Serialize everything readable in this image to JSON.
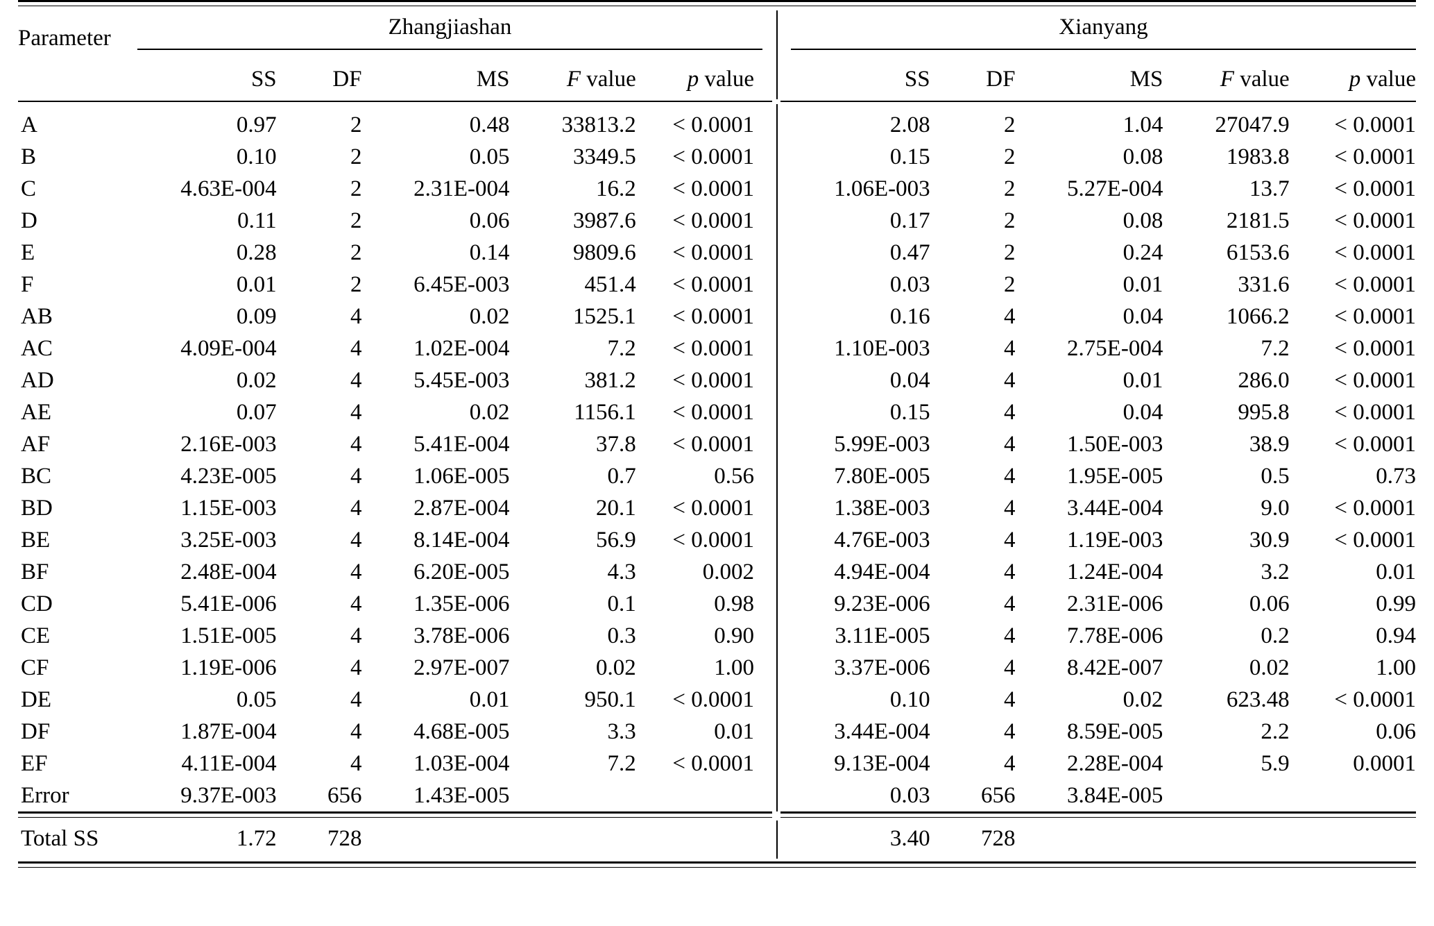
{
  "table": {
    "param_header": "Parameter",
    "groups": [
      {
        "name": "Zhangjiashan"
      },
      {
        "name": "Xianyang"
      }
    ],
    "columns": [
      {
        "key": "ss",
        "label": "SS"
      },
      {
        "key": "df",
        "label": "DF"
      },
      {
        "key": "ms",
        "label": "MS"
      },
      {
        "key": "f",
        "label_italic": "F",
        "label_rest": " value"
      },
      {
        "key": "p",
        "label_italic": "p",
        "label_rest": " value"
      }
    ],
    "rows": [
      {
        "param": "A",
        "z": {
          "ss": "0.97",
          "df": "2",
          "ms": "0.48",
          "f": "33813.2",
          "p": "< 0.0001"
        },
        "x": {
          "ss": "2.08",
          "df": "2",
          "ms": "1.04",
          "f": "27047.9",
          "p": "< 0.0001"
        }
      },
      {
        "param": "B",
        "z": {
          "ss": "0.10",
          "df": "2",
          "ms": "0.05",
          "f": "3349.5",
          "p": "< 0.0001"
        },
        "x": {
          "ss": "0.15",
          "df": "2",
          "ms": "0.08",
          "f": "1983.8",
          "p": "< 0.0001"
        }
      },
      {
        "param": "C",
        "z": {
          "ss": "4.63E-004",
          "df": "2",
          "ms": "2.31E-004",
          "f": "16.2",
          "p": "< 0.0001"
        },
        "x": {
          "ss": "1.06E-003",
          "df": "2",
          "ms": "5.27E-004",
          "f": "13.7",
          "p": "< 0.0001"
        }
      },
      {
        "param": "D",
        "z": {
          "ss": "0.11",
          "df": "2",
          "ms": "0.06",
          "f": "3987.6",
          "p": "< 0.0001"
        },
        "x": {
          "ss": "0.17",
          "df": "2",
          "ms": "0.08",
          "f": "2181.5",
          "p": "< 0.0001"
        }
      },
      {
        "param": "E",
        "z": {
          "ss": "0.28",
          "df": "2",
          "ms": "0.14",
          "f": "9809.6",
          "p": "< 0.0001"
        },
        "x": {
          "ss": "0.47",
          "df": "2",
          "ms": "0.24",
          "f": "6153.6",
          "p": "< 0.0001"
        }
      },
      {
        "param": "F",
        "z": {
          "ss": "0.01",
          "df": "2",
          "ms": "6.45E-003",
          "f": "451.4",
          "p": "< 0.0001"
        },
        "x": {
          "ss": "0.03",
          "df": "2",
          "ms": "0.01",
          "f": "331.6",
          "p": "< 0.0001"
        }
      },
      {
        "param": "AB",
        "z": {
          "ss": "0.09",
          "df": "4",
          "ms": "0.02",
          "f": "1525.1",
          "p": "< 0.0001"
        },
        "x": {
          "ss": "0.16",
          "df": "4",
          "ms": "0.04",
          "f": "1066.2",
          "p": "< 0.0001"
        }
      },
      {
        "param": "AC",
        "z": {
          "ss": "4.09E-004",
          "df": "4",
          "ms": "1.02E-004",
          "f": "7.2",
          "p": "< 0.0001"
        },
        "x": {
          "ss": "1.10E-003",
          "df": "4",
          "ms": "2.75E-004",
          "f": "7.2",
          "p": "< 0.0001"
        }
      },
      {
        "param": "AD",
        "z": {
          "ss": "0.02",
          "df": "4",
          "ms": "5.45E-003",
          "f": "381.2",
          "p": "< 0.0001"
        },
        "x": {
          "ss": "0.04",
          "df": "4",
          "ms": "0.01",
          "f": "286.0",
          "p": "< 0.0001"
        }
      },
      {
        "param": "AE",
        "z": {
          "ss": "0.07",
          "df": "4",
          "ms": "0.02",
          "f": "1156.1",
          "p": "< 0.0001"
        },
        "x": {
          "ss": "0.15",
          "df": "4",
          "ms": "0.04",
          "f": "995.8",
          "p": "< 0.0001"
        }
      },
      {
        "param": "AF",
        "z": {
          "ss": "2.16E-003",
          "df": "4",
          "ms": "5.41E-004",
          "f": "37.8",
          "p": "< 0.0001"
        },
        "x": {
          "ss": "5.99E-003",
          "df": "4",
          "ms": "1.50E-003",
          "f": "38.9",
          "p": "< 0.0001"
        }
      },
      {
        "param": "BC",
        "z": {
          "ss": "4.23E-005",
          "df": "4",
          "ms": "1.06E-005",
          "f": "0.7",
          "p": "0.56"
        },
        "x": {
          "ss": "7.80E-005",
          "df": "4",
          "ms": "1.95E-005",
          "f": "0.5",
          "p": "0.73"
        }
      },
      {
        "param": "BD",
        "z": {
          "ss": "1.15E-003",
          "df": "4",
          "ms": "2.87E-004",
          "f": "20.1",
          "p": "< 0.0001"
        },
        "x": {
          "ss": "1.38E-003",
          "df": "4",
          "ms": "3.44E-004",
          "f": "9.0",
          "p": "< 0.0001"
        }
      },
      {
        "param": "BE",
        "z": {
          "ss": "3.25E-003",
          "df": "4",
          "ms": "8.14E-004",
          "f": "56.9",
          "p": "< 0.0001"
        },
        "x": {
          "ss": "4.76E-003",
          "df": "4",
          "ms": "1.19E-003",
          "f": "30.9",
          "p": "< 0.0001"
        }
      },
      {
        "param": "BF",
        "z": {
          "ss": "2.48E-004",
          "df": "4",
          "ms": "6.20E-005",
          "f": "4.3",
          "p": "0.002"
        },
        "x": {
          "ss": "4.94E-004",
          "df": "4",
          "ms": "1.24E-004",
          "f": "3.2",
          "p": "0.01"
        }
      },
      {
        "param": "CD",
        "z": {
          "ss": "5.41E-006",
          "df": "4",
          "ms": "1.35E-006",
          "f": "0.1",
          "p": "0.98"
        },
        "x": {
          "ss": "9.23E-006",
          "df": "4",
          "ms": "2.31E-006",
          "f": "0.06",
          "p": "0.99"
        }
      },
      {
        "param": "CE",
        "z": {
          "ss": "1.51E-005",
          "df": "4",
          "ms": "3.78E-006",
          "f": "0.3",
          "p": "0.90"
        },
        "x": {
          "ss": "3.11E-005",
          "df": "4",
          "ms": "7.78E-006",
          "f": "0.2",
          "p": "0.94"
        }
      },
      {
        "param": "CF",
        "z": {
          "ss": "1.19E-006",
          "df": "4",
          "ms": "2.97E-007",
          "f": "0.02",
          "p": "1.00"
        },
        "x": {
          "ss": "3.37E-006",
          "df": "4",
          "ms": "8.42E-007",
          "f": "0.02",
          "p": "1.00"
        }
      },
      {
        "param": "DE",
        "z": {
          "ss": "0.05",
          "df": "4",
          "ms": "0.01",
          "f": "950.1",
          "p": "< 0.0001"
        },
        "x": {
          "ss": "0.10",
          "df": "4",
          "ms": "0.02",
          "f": "623.48",
          "p": "< 0.0001"
        }
      },
      {
        "param": "DF",
        "z": {
          "ss": "1.87E-004",
          "df": "4",
          "ms": "4.68E-005",
          "f": "3.3",
          "p": "0.01"
        },
        "x": {
          "ss": "3.44E-004",
          "df": "4",
          "ms": "8.59E-005",
          "f": "2.2",
          "p": "0.06"
        }
      },
      {
        "param": "EF",
        "z": {
          "ss": "4.11E-004",
          "df": "4",
          "ms": "1.03E-004",
          "f": "7.2",
          "p": "< 0.0001"
        },
        "x": {
          "ss": "9.13E-004",
          "df": "4",
          "ms": "2.28E-004",
          "f": "5.9",
          "p": "0.0001"
        }
      },
      {
        "param": "Error",
        "z": {
          "ss": "9.37E-003",
          "df": "656",
          "ms": "1.43E-005",
          "f": "",
          "p": ""
        },
        "x": {
          "ss": "0.03",
          "df": "656",
          "ms": "3.84E-005",
          "f": "",
          "p": ""
        }
      }
    ],
    "total_row": {
      "param": "Total SS",
      "z": {
        "ss": "1.72",
        "df": "728",
        "ms": "",
        "f": "",
        "p": ""
      },
      "x": {
        "ss": "3.40",
        "df": "728",
        "ms": "",
        "f": "",
        "p": ""
      }
    }
  },
  "chart_data": {
    "type": "table",
    "title": "ANOVA results for Zhangjiashan and Xianyang",
    "row_key": "Parameter",
    "groups": [
      "Zhangjiashan",
      "Xianyang"
    ],
    "columns": [
      "SS",
      "DF",
      "MS",
      "F value",
      "p value"
    ],
    "categories": [
      "A",
      "B",
      "C",
      "D",
      "E",
      "F",
      "AB",
      "AC",
      "AD",
      "AE",
      "AF",
      "BC",
      "BD",
      "BE",
      "BF",
      "CD",
      "CE",
      "CF",
      "DE",
      "DF",
      "EF",
      "Error",
      "Total SS"
    ],
    "series": [
      {
        "name": "Zhangjiashan F value",
        "values": [
          33813.2,
          3349.5,
          16.2,
          3987.6,
          9809.6,
          451.4,
          1525.1,
          7.2,
          381.2,
          1156.1,
          37.8,
          0.7,
          20.1,
          56.9,
          4.3,
          0.1,
          0.3,
          0.02,
          950.1,
          3.3,
          7.2,
          null,
          null
        ]
      },
      {
        "name": "Xianyang F value",
        "values": [
          27047.9,
          1983.8,
          13.7,
          2181.5,
          6153.6,
          331.6,
          1066.2,
          7.2,
          286.0,
          995.8,
          38.9,
          0.5,
          9.0,
          30.9,
          3.2,
          0.06,
          0.2,
          0.02,
          623.48,
          2.2,
          5.9,
          null,
          null
        ]
      },
      {
        "name": "Zhangjiashan SS",
        "values": [
          0.97,
          0.1,
          0.000463,
          0.11,
          0.28,
          0.01,
          0.09,
          0.000409,
          0.02,
          0.07,
          0.00216,
          4.23e-05,
          0.00115,
          0.00325,
          0.000248,
          5.41e-06,
          1.51e-05,
          1.19e-06,
          0.05,
          0.000187,
          0.000411,
          0.00937,
          1.72
        ]
      },
      {
        "name": "Xianyang SS",
        "values": [
          2.08,
          0.15,
          0.00106,
          0.17,
          0.47,
          0.03,
          0.16,
          0.0011,
          0.04,
          0.15,
          0.00599,
          7.8e-05,
          0.00138,
          0.00476,
          0.000494,
          9.23e-06,
          3.11e-05,
          3.37e-06,
          0.1,
          0.000344,
          0.000913,
          0.03,
          3.4
        ]
      },
      {
        "name": "Zhangjiashan DF",
        "values": [
          2,
          2,
          2,
          2,
          2,
          2,
          4,
          4,
          4,
          4,
          4,
          4,
          4,
          4,
          4,
          4,
          4,
          4,
          4,
          4,
          4,
          656,
          728
        ]
      },
      {
        "name": "Xianyang DF",
        "values": [
          2,
          2,
          2,
          2,
          2,
          2,
          4,
          4,
          4,
          4,
          4,
          4,
          4,
          4,
          4,
          4,
          4,
          4,
          4,
          4,
          4,
          656,
          728
        ]
      }
    ]
  }
}
